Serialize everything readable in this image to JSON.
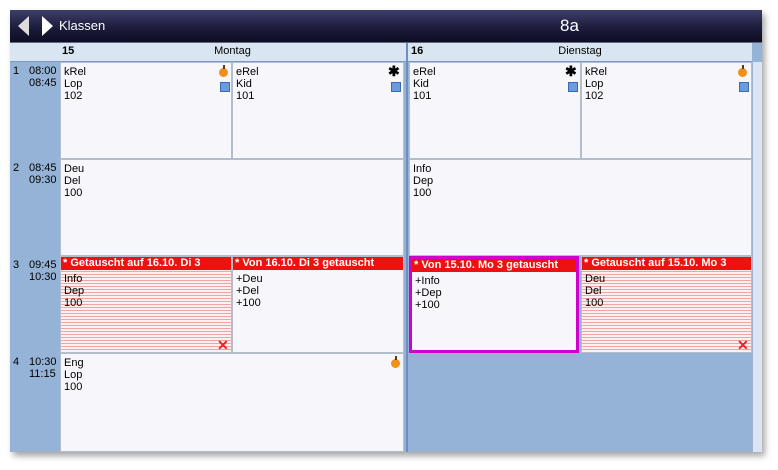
{
  "titlebar": {
    "back_label": "Klassen",
    "class_name": "8a"
  },
  "days": [
    {
      "num": "15",
      "name": "Montag"
    },
    {
      "num": "16",
      "name": "Dienstag"
    }
  ],
  "periods": [
    {
      "num": "1",
      "start": "08:00",
      "end": "08:45"
    },
    {
      "num": "2",
      "start": "08:45",
      "end": "09:30"
    },
    {
      "num": "3",
      "start": "09:45",
      "end": "10:30"
    },
    {
      "num": "4",
      "start": "10:30",
      "end": "11:15"
    }
  ],
  "lessons": {
    "mon_p1_a": [
      "kRel",
      "Lop",
      "102"
    ],
    "mon_p1_b": [
      "eRel",
      "Kid",
      "101"
    ],
    "mon_p2": [
      "Deu",
      "Del",
      "100"
    ],
    "mon_p3_a": {
      "banner": "* Getauscht auf 16.10. Di 3",
      "lines": [
        "Info",
        "Dep",
        "100"
      ]
    },
    "mon_p3_b": {
      "banner": "* Von 16.10. Di 3 getauscht",
      "lines": [
        "+Deu",
        "+Del",
        "+100"
      ]
    },
    "mon_p4": [
      "Eng",
      "Lop",
      "100"
    ],
    "tue_p1_a": [
      "eRel",
      "Kid",
      "101"
    ],
    "tue_p1_b": [
      "kRel",
      "Lop",
      "102"
    ],
    "tue_p2": [
      "Info",
      "Dep",
      "100"
    ],
    "tue_p3_a": {
      "banner": "* Von 15.10. Mo 3 getauscht",
      "lines": [
        "+Info",
        "+Dep",
        "+100"
      ]
    },
    "tue_p3_b": {
      "banner": "* Getauscht auf 15.10. Mo 3",
      "lines": [
        "Deu",
        "Del",
        "100"
      ]
    }
  },
  "icons": {
    "nav_prev": "triangle-left-icon",
    "nav_next": "triangle-right-icon",
    "religion_catholic": "orange-apple-icon",
    "religion_evangelic": "asterisk-icon",
    "room": "blue-square-icon",
    "cancelled": "red-x-icon"
  },
  "colors": {
    "titlebar": "#1c1c3c",
    "background": "#95b3d7",
    "banner": "#ee1111",
    "selection": "#d000d0",
    "cancel_stripes": "#f2a3a3"
  }
}
